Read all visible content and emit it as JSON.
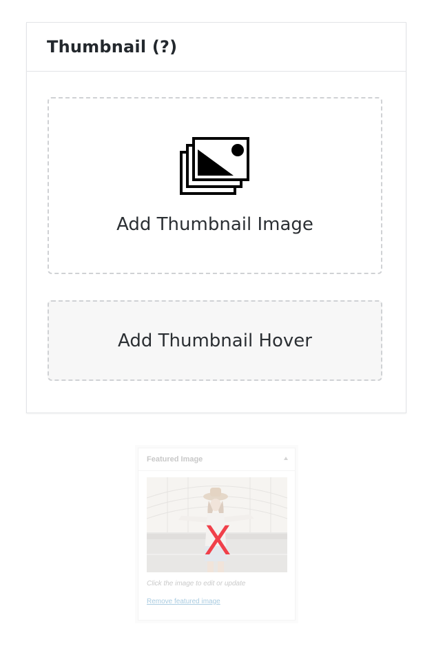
{
  "thumbnail_box": {
    "title": "Thumbnail (?)",
    "add_image_label": "Add Thumbnail Image",
    "add_hover_label": "Add Thumbnail Hover",
    "image_icon": "images-stack-icon"
  },
  "featured_image": {
    "title": "Featured Image",
    "caption": "Click the image to edit or update",
    "remove_link": "Remove featured image",
    "overlay_mark": "X",
    "overlay_color": "#f0404a",
    "link_color": "#a9cbe0"
  }
}
